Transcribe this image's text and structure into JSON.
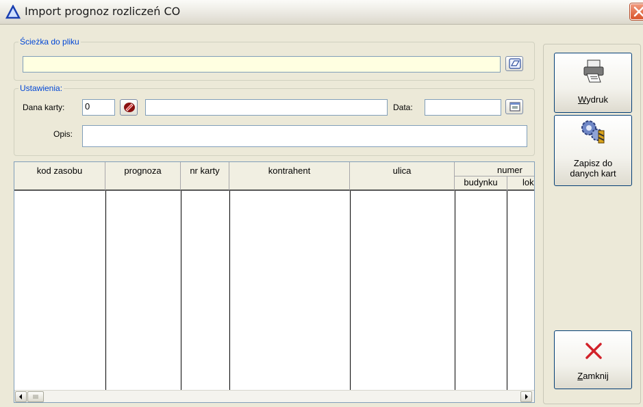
{
  "window": {
    "title": "Import prognoz rozliczeń CO",
    "icon": "triangle-delta-icon",
    "close_icon": "close-icon"
  },
  "file_path": {
    "legend": "Ścieżka do pliku",
    "value": "",
    "browse_icon": "folder-open-icon"
  },
  "settings": {
    "legend": "Ustawienia:",
    "card_label": "Dana karty:",
    "card_value": "0",
    "card_lookup_icon": "book-icon",
    "card_name_value": "",
    "date_label": "Data:",
    "date_value": "",
    "calendar_icon": "calendar-icon",
    "description_label": "Opis:",
    "description_value": ""
  },
  "table": {
    "columns": [
      "kod zasobu",
      "prognoza",
      "nr karty",
      "kontrahent",
      "ulica"
    ],
    "group_header": "numer",
    "sub_columns": [
      "budynku",
      "lok"
    ],
    "rows": []
  },
  "buttons": {
    "print_first": "W",
    "print_rest": "ydruk",
    "save_line1": "Zapisz do",
    "save_line2": "danych kart",
    "close_first": "Z",
    "close_rest": "amknij"
  },
  "colors": {
    "legend": "#0046d5",
    "path_field": "#ffffe1",
    "close_x": "#d2222a"
  }
}
